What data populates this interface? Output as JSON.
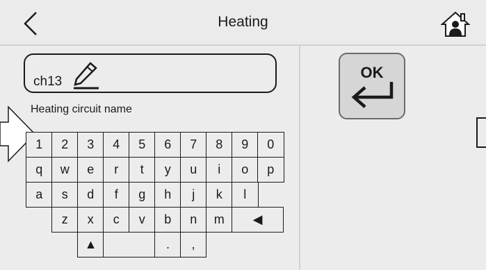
{
  "header": {
    "title": "Heating",
    "back_icon": "chevron-left-icon",
    "home_icon": "home-icon"
  },
  "field": {
    "value": "ch13",
    "label": "Heating circuit name",
    "edit_icon": "pencil-icon"
  },
  "ok_button": {
    "label": "OK",
    "icon": "enter-arrow-icon"
  },
  "keyboard": {
    "row1": [
      "1",
      "2",
      "3",
      "4",
      "5",
      "6",
      "7",
      "8",
      "9",
      "0"
    ],
    "row2": [
      "q",
      "w",
      "e",
      "r",
      "t",
      "y",
      "u",
      "i",
      "o",
      "p"
    ],
    "row3": [
      "a",
      "s",
      "d",
      "f",
      "g",
      "h",
      "j",
      "k",
      "l"
    ],
    "row4": [
      "z",
      "x",
      "c",
      "v",
      "b",
      "n",
      "m"
    ],
    "backspace": "◀",
    "shift": "▲",
    "dot": ".",
    "comma": ","
  }
}
